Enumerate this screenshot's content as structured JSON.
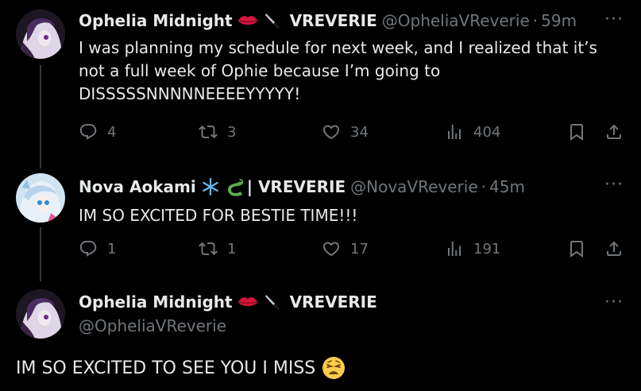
{
  "tweets": [
    {
      "name": "Ophelia Midnight",
      "group": "VREVERIE",
      "handle": "@OpheliaVReverie",
      "time": "59m",
      "text_lines": [
        "I was planning my schedule for next week, and I realized that it’s",
        "not a full week of Ophie because I’m going to",
        "DISSSSSNNNNNEEEEYYYYY!"
      ],
      "replies": "4",
      "reposts": "3",
      "likes": "34",
      "views": "404"
    },
    {
      "name": "Nova Aokami",
      "group": "| VREVERIE",
      "handle": "@NovaVReverie",
      "time": "45m",
      "text": "IM SO EXCITED FOR BESTIE TIME!!!",
      "replies": "1",
      "reposts": "1",
      "likes": "17",
      "views": "191"
    },
    {
      "name": "Ophelia Midnight",
      "group": "VREVERIE",
      "handle": "@OpheliaVReverie",
      "text": "IM SO EXCITED TO SEE YOU I MISS"
    }
  ],
  "icons": {
    "reply": "reply-icon",
    "repost": "repost-icon",
    "like": "heart-icon",
    "views": "views-icon",
    "bookmark": "bookmark-icon",
    "share": "share-icon",
    "more": "more-icon"
  },
  "colors": {
    "background": "#000000",
    "text": "#e7e9ea",
    "muted": "#71767b",
    "thread_line": "#333639"
  },
  "separator": "·",
  "more_glyph": "···"
}
